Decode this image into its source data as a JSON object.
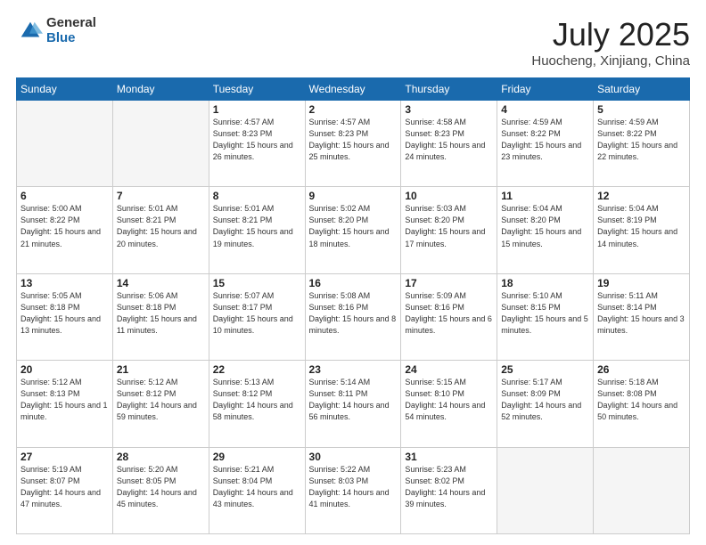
{
  "header": {
    "logo_general": "General",
    "logo_blue": "Blue",
    "month": "July 2025",
    "location": "Huocheng, Xinjiang, China"
  },
  "weekdays": [
    "Sunday",
    "Monday",
    "Tuesday",
    "Wednesday",
    "Thursday",
    "Friday",
    "Saturday"
  ],
  "weeks": [
    [
      {
        "day": "",
        "empty": true
      },
      {
        "day": "",
        "empty": true
      },
      {
        "day": "1",
        "sunrise": "Sunrise: 4:57 AM",
        "sunset": "Sunset: 8:23 PM",
        "daylight": "Daylight: 15 hours and 26 minutes."
      },
      {
        "day": "2",
        "sunrise": "Sunrise: 4:57 AM",
        "sunset": "Sunset: 8:23 PM",
        "daylight": "Daylight: 15 hours and 25 minutes."
      },
      {
        "day": "3",
        "sunrise": "Sunrise: 4:58 AM",
        "sunset": "Sunset: 8:23 PM",
        "daylight": "Daylight: 15 hours and 24 minutes."
      },
      {
        "day": "4",
        "sunrise": "Sunrise: 4:59 AM",
        "sunset": "Sunset: 8:22 PM",
        "daylight": "Daylight: 15 hours and 23 minutes."
      },
      {
        "day": "5",
        "sunrise": "Sunrise: 4:59 AM",
        "sunset": "Sunset: 8:22 PM",
        "daylight": "Daylight: 15 hours and 22 minutes."
      }
    ],
    [
      {
        "day": "6",
        "sunrise": "Sunrise: 5:00 AM",
        "sunset": "Sunset: 8:22 PM",
        "daylight": "Daylight: 15 hours and 21 minutes."
      },
      {
        "day": "7",
        "sunrise": "Sunrise: 5:01 AM",
        "sunset": "Sunset: 8:21 PM",
        "daylight": "Daylight: 15 hours and 20 minutes."
      },
      {
        "day": "8",
        "sunrise": "Sunrise: 5:01 AM",
        "sunset": "Sunset: 8:21 PM",
        "daylight": "Daylight: 15 hours and 19 minutes."
      },
      {
        "day": "9",
        "sunrise": "Sunrise: 5:02 AM",
        "sunset": "Sunset: 8:20 PM",
        "daylight": "Daylight: 15 hours and 18 minutes."
      },
      {
        "day": "10",
        "sunrise": "Sunrise: 5:03 AM",
        "sunset": "Sunset: 8:20 PM",
        "daylight": "Daylight: 15 hours and 17 minutes."
      },
      {
        "day": "11",
        "sunrise": "Sunrise: 5:04 AM",
        "sunset": "Sunset: 8:20 PM",
        "daylight": "Daylight: 15 hours and 15 minutes."
      },
      {
        "day": "12",
        "sunrise": "Sunrise: 5:04 AM",
        "sunset": "Sunset: 8:19 PM",
        "daylight": "Daylight: 15 hours and 14 minutes."
      }
    ],
    [
      {
        "day": "13",
        "sunrise": "Sunrise: 5:05 AM",
        "sunset": "Sunset: 8:18 PM",
        "daylight": "Daylight: 15 hours and 13 minutes."
      },
      {
        "day": "14",
        "sunrise": "Sunrise: 5:06 AM",
        "sunset": "Sunset: 8:18 PM",
        "daylight": "Daylight: 15 hours and 11 minutes."
      },
      {
        "day": "15",
        "sunrise": "Sunrise: 5:07 AM",
        "sunset": "Sunset: 8:17 PM",
        "daylight": "Daylight: 15 hours and 10 minutes."
      },
      {
        "day": "16",
        "sunrise": "Sunrise: 5:08 AM",
        "sunset": "Sunset: 8:16 PM",
        "daylight": "Daylight: 15 hours and 8 minutes."
      },
      {
        "day": "17",
        "sunrise": "Sunrise: 5:09 AM",
        "sunset": "Sunset: 8:16 PM",
        "daylight": "Daylight: 15 hours and 6 minutes."
      },
      {
        "day": "18",
        "sunrise": "Sunrise: 5:10 AM",
        "sunset": "Sunset: 8:15 PM",
        "daylight": "Daylight: 15 hours and 5 minutes."
      },
      {
        "day": "19",
        "sunrise": "Sunrise: 5:11 AM",
        "sunset": "Sunset: 8:14 PM",
        "daylight": "Daylight: 15 hours and 3 minutes."
      }
    ],
    [
      {
        "day": "20",
        "sunrise": "Sunrise: 5:12 AM",
        "sunset": "Sunset: 8:13 PM",
        "daylight": "Daylight: 15 hours and 1 minute."
      },
      {
        "day": "21",
        "sunrise": "Sunrise: 5:12 AM",
        "sunset": "Sunset: 8:12 PM",
        "daylight": "Daylight: 14 hours and 59 minutes."
      },
      {
        "day": "22",
        "sunrise": "Sunrise: 5:13 AM",
        "sunset": "Sunset: 8:12 PM",
        "daylight": "Daylight: 14 hours and 58 minutes."
      },
      {
        "day": "23",
        "sunrise": "Sunrise: 5:14 AM",
        "sunset": "Sunset: 8:11 PM",
        "daylight": "Daylight: 14 hours and 56 minutes."
      },
      {
        "day": "24",
        "sunrise": "Sunrise: 5:15 AM",
        "sunset": "Sunset: 8:10 PM",
        "daylight": "Daylight: 14 hours and 54 minutes."
      },
      {
        "day": "25",
        "sunrise": "Sunrise: 5:17 AM",
        "sunset": "Sunset: 8:09 PM",
        "daylight": "Daylight: 14 hours and 52 minutes."
      },
      {
        "day": "26",
        "sunrise": "Sunrise: 5:18 AM",
        "sunset": "Sunset: 8:08 PM",
        "daylight": "Daylight: 14 hours and 50 minutes."
      }
    ],
    [
      {
        "day": "27",
        "sunrise": "Sunrise: 5:19 AM",
        "sunset": "Sunset: 8:07 PM",
        "daylight": "Daylight: 14 hours and 47 minutes."
      },
      {
        "day": "28",
        "sunrise": "Sunrise: 5:20 AM",
        "sunset": "Sunset: 8:05 PM",
        "daylight": "Daylight: 14 hours and 45 minutes."
      },
      {
        "day": "29",
        "sunrise": "Sunrise: 5:21 AM",
        "sunset": "Sunset: 8:04 PM",
        "daylight": "Daylight: 14 hours and 43 minutes."
      },
      {
        "day": "30",
        "sunrise": "Sunrise: 5:22 AM",
        "sunset": "Sunset: 8:03 PM",
        "daylight": "Daylight: 14 hours and 41 minutes."
      },
      {
        "day": "31",
        "sunrise": "Sunrise: 5:23 AM",
        "sunset": "Sunset: 8:02 PM",
        "daylight": "Daylight: 14 hours and 39 minutes."
      },
      {
        "day": "",
        "empty": true
      },
      {
        "day": "",
        "empty": true
      }
    ]
  ]
}
